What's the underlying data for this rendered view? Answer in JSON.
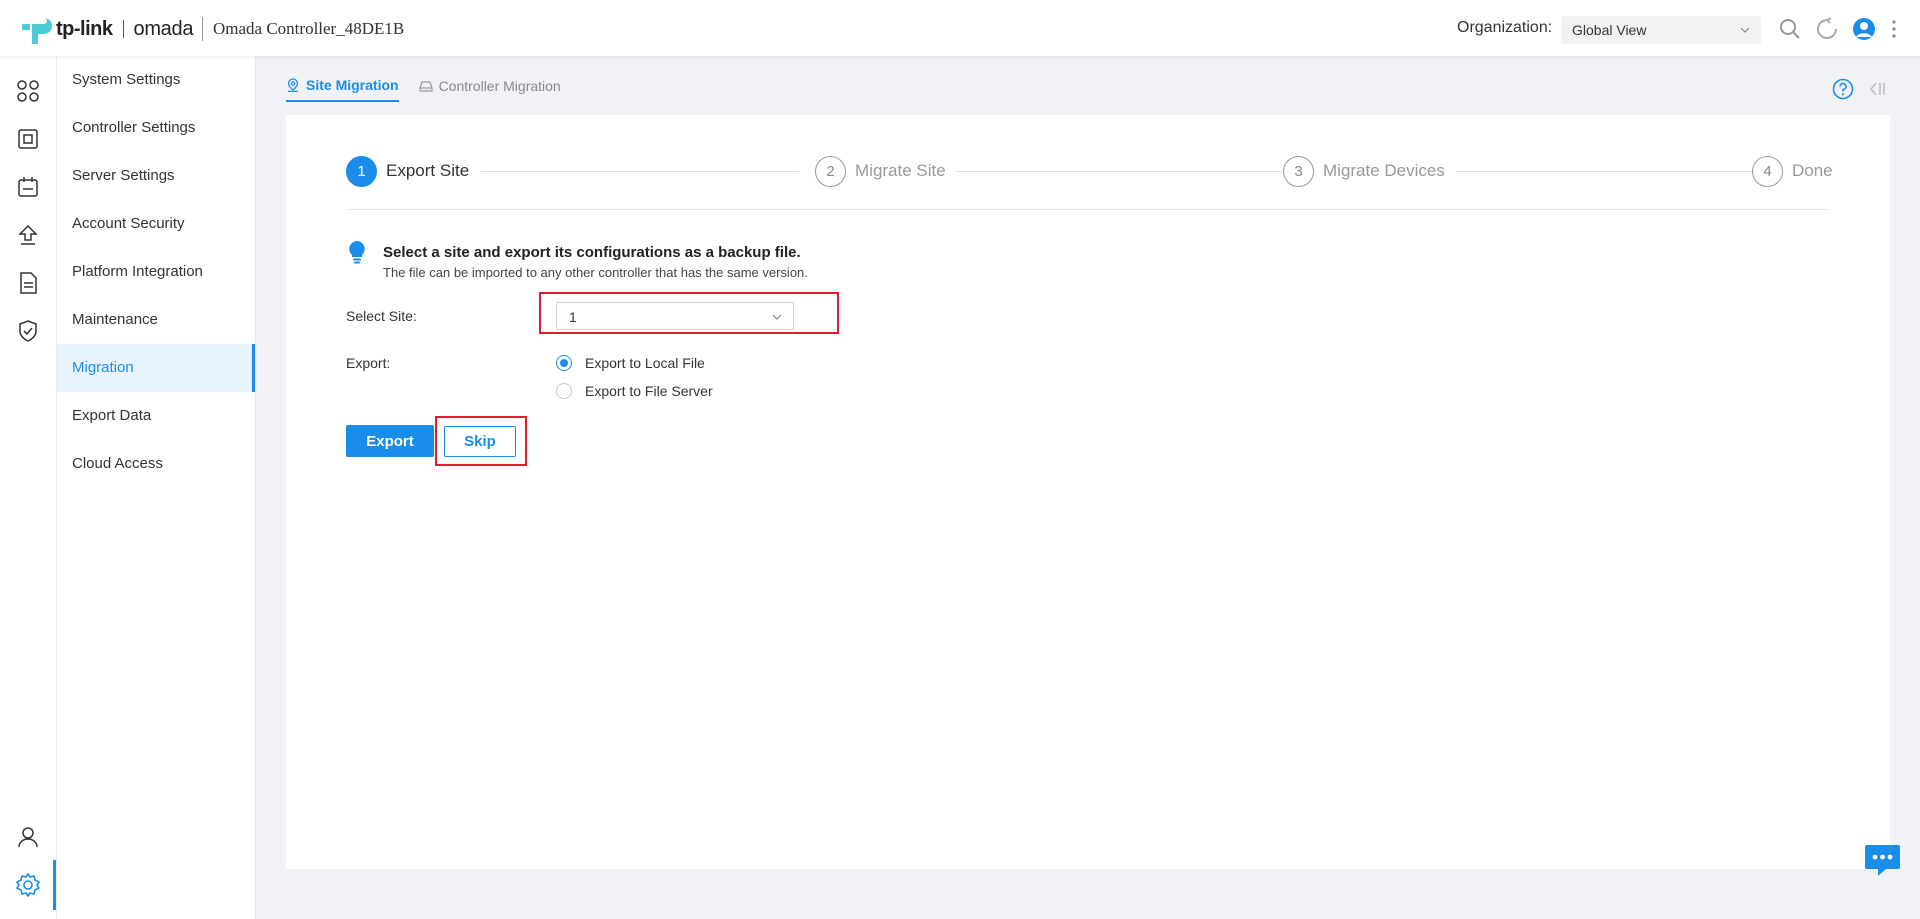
{
  "header": {
    "brand": "tp-link",
    "product": "omada",
    "app_title": "Omada Controller_48DE1B",
    "org_label": "Organization:",
    "org_value": "Global View"
  },
  "rail": {
    "icons": [
      "dashboard-icon",
      "devices-icon",
      "schedule-icon",
      "upgrade-icon",
      "logs-icon",
      "security-shield-icon",
      "user-icon",
      "settings-gear-icon"
    ],
    "active": "settings-gear-icon"
  },
  "menu": {
    "items": [
      {
        "label": "System Settings"
      },
      {
        "label": "Controller Settings"
      },
      {
        "label": "Server Settings"
      },
      {
        "label": "Account Security"
      },
      {
        "label": "Platform Integration"
      },
      {
        "label": "Maintenance"
      },
      {
        "label": "Migration"
      },
      {
        "label": "Export Data"
      },
      {
        "label": "Cloud Access"
      }
    ],
    "active": "Migration"
  },
  "tabs": [
    {
      "label": "Site Migration",
      "active": true
    },
    {
      "label": "Controller Migration",
      "active": false
    }
  ],
  "steps": [
    {
      "number": "1",
      "label": "Export Site",
      "current": true
    },
    {
      "number": "2",
      "label": "Migrate Site",
      "current": false
    },
    {
      "number": "3",
      "label": "Migrate Devices",
      "current": false
    },
    {
      "number": "4",
      "label": "Done",
      "current": false
    }
  ],
  "tip": {
    "title": "Select a site and export its configurations as a backup file.",
    "subtitle": "The file can be imported to any other controller that has the same version."
  },
  "form": {
    "select_site_label": "Select Site:",
    "select_site_value": "1",
    "export_label": "Export:",
    "export_options": [
      {
        "label": "Export to Local File",
        "checked": true
      },
      {
        "label": "Export to File Server",
        "checked": false
      }
    ]
  },
  "buttons": {
    "export": "Export",
    "skip": "Skip"
  },
  "colors": {
    "accent": "#1a8dea",
    "highlight": "#e41b2c",
    "brand_teal": "#4acbd6"
  }
}
